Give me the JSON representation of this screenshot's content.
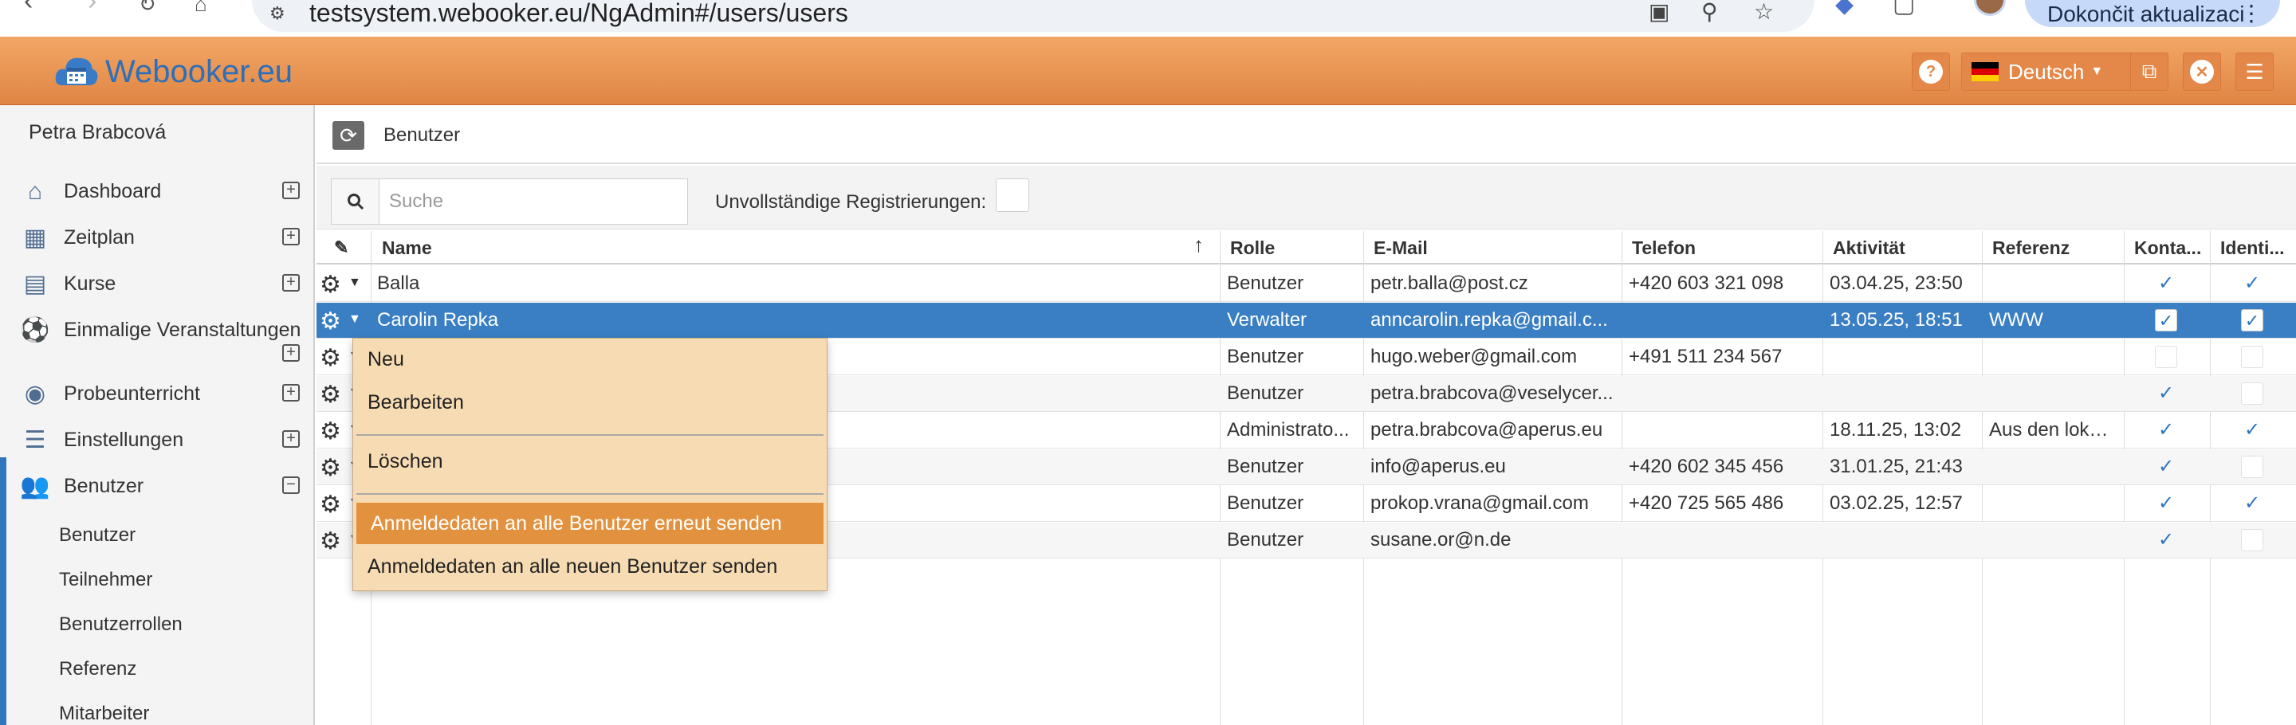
{
  "browser": {
    "url": "testsystem.webooker.eu/NgAdmin#/users/users",
    "update_label": "Dokončit aktualizaci"
  },
  "header": {
    "brand": "Webooker.eu",
    "language": "Deutsch",
    "accent_color": "#e8904f"
  },
  "sidebar": {
    "user_name": "Petra Brabcová",
    "items": [
      {
        "label": "Dashboard",
        "icon": "home-icon"
      },
      {
        "label": "Zeitplan",
        "icon": "calendar-icon"
      },
      {
        "label": "Kurse",
        "icon": "book-icon"
      },
      {
        "label": "Einmalige Veranstaltungen",
        "icon": "soccer-ball-icon"
      },
      {
        "label": "Probeunterricht",
        "icon": "eye-icon"
      },
      {
        "label": "Einstellungen",
        "icon": "sliders-icon"
      },
      {
        "label": "Benutzer",
        "icon": "users-icon"
      }
    ],
    "sub_items": [
      "Benutzer",
      "Teilnehmer",
      "Benutzerrollen",
      "Referenz",
      "Mitarbeiter"
    ]
  },
  "main": {
    "breadcrumb": "Benutzer",
    "search_placeholder": "Suche",
    "incomplete_label": "Unvollständige Registrierungen:"
  },
  "grid": {
    "columns": [
      "Name",
      "Rolle",
      "E-Mail",
      "Telefon",
      "Aktivität",
      "Referenz",
      "Konta...",
      "Identi..."
    ],
    "rows": [
      {
        "name": "Balla",
        "role": "Benutzer",
        "email": "petr.balla@post.cz",
        "phone": "+420 603 321 098",
        "activity": "03.04.25, 23:50",
        "referenz": "",
        "kontakt": true,
        "ident": true
      },
      {
        "name": "Carolin Repka",
        "role": "Verwalter",
        "email": "anncarolin.repka@gmail.c...",
        "phone": "",
        "activity": "13.05.25, 18:51",
        "referenz": "WWW",
        "kontakt": true,
        "ident": true
      },
      {
        "name": "",
        "role": "Benutzer",
        "email": "hugo.weber@gmail.com",
        "phone": "+491 511 234 567",
        "activity": "",
        "referenz": "",
        "kontakt": false,
        "ident": false
      },
      {
        "name": "",
        "role": "Benutzer",
        "email": "petra.brabcova@veselycer...",
        "phone": "",
        "activity": "",
        "referenz": "",
        "kontakt": true,
        "ident": false
      },
      {
        "name": "",
        "role": "Administrato...",
        "email": "petra.brabcova@aperus.eu",
        "phone": "",
        "activity": "18.11.25, 13:02",
        "referenz": "Aus den lokal...",
        "kontakt": true,
        "ident": true
      },
      {
        "name": "",
        "role": "Benutzer",
        "email": "info@aperus.eu",
        "phone": "+420 602 345 456",
        "activity": "31.01.25, 21:43",
        "referenz": "",
        "kontakt": true,
        "ident": false
      },
      {
        "name": "",
        "role": "Benutzer",
        "email": "prokop.vrana@gmail.com",
        "phone": "+420 725 565 486",
        "activity": "03.02.25, 12:57",
        "referenz": "",
        "kontakt": true,
        "ident": true
      },
      {
        "name": "",
        "role": "Benutzer",
        "email": "susane.or@n.de",
        "phone": "",
        "activity": "",
        "referenz": "",
        "kontakt": true,
        "ident": false
      }
    ]
  },
  "context_menu": {
    "items": [
      "Neu",
      "Bearbeiten",
      "Löschen",
      "Anmeldedaten an alle Benutzer erneut senden",
      "Anmeldedaten an alle neuen Benutzer senden"
    ]
  }
}
